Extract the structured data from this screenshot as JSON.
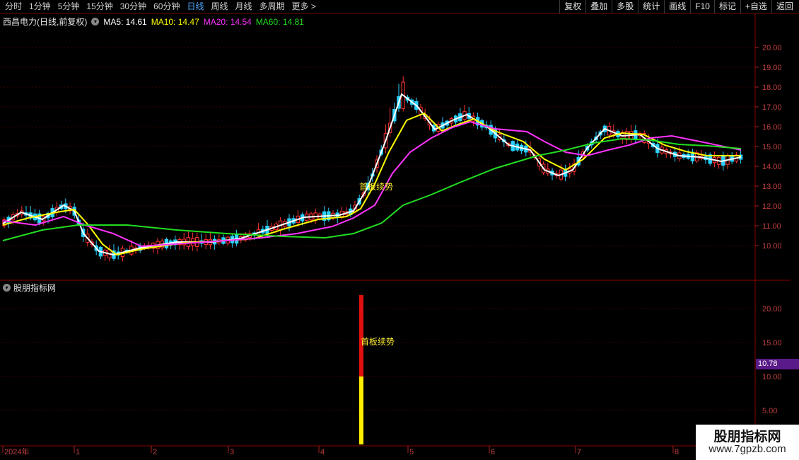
{
  "toolbar": {
    "periods": [
      "分时",
      "1分钟",
      "5分钟",
      "15分钟",
      "30分钟",
      "60分钟",
      "日线",
      "周线",
      "月线",
      "多周期",
      "更多 >"
    ],
    "active_index": 6,
    "buttons": [
      "复权",
      "叠加",
      "多股",
      "统计",
      "画线",
      "F10",
      "标记",
      "+自选",
      "返回"
    ]
  },
  "info": {
    "stock_name": "西昌电力(日线,前复权)",
    "ma5": "MA5: 14.61",
    "ma10": "MA10: 14.47",
    "ma20": "MA20: 14.54",
    "ma60": "MA60: 14.81",
    "colors": {
      "ma5": "#ffffff",
      "ma10": "#ffff00",
      "ma20": "#ff33ff",
      "ma60": "#22dd22"
    }
  },
  "indicator": {
    "title": "股朋指标网",
    "signal_label": "首板续势",
    "current_value": "10.78"
  },
  "watermark": {
    "line1": "股朋指标网",
    "line2": "www.7gpzb.com"
  },
  "chart_data": {
    "type": "candlestick",
    "price_axis_ticks": [
      "20.00",
      "19.00",
      "18.00",
      "17.00",
      "16.00",
      "15.00",
      "14.00",
      "13.00",
      "12.00",
      "11.00",
      "10.00"
    ],
    "indicator_axis_ticks": [
      "20.00",
      "15.00",
      "10.00",
      "5.00"
    ],
    "x_axis_labels": [
      "2024年",
      "1",
      "2",
      "3",
      "4",
      "5",
      "6",
      "7",
      "8"
    ],
    "ylim": [
      9,
      21
    ],
    "annotation": {
      "text": "首板续势",
      "price": 12.9
    },
    "indicator_bar": {
      "red_range": [
        10.0,
        22.0
      ],
      "yellow_range": [
        0,
        10.0
      ]
    },
    "series": [
      {
        "name": "MA5",
        "color": "#ffffff"
      },
      {
        "name": "MA10",
        "color": "#ffff00"
      },
      {
        "name": "MA20",
        "color": "#ff33ff"
      },
      {
        "name": "MA60",
        "color": "#22dd22"
      }
    ]
  }
}
